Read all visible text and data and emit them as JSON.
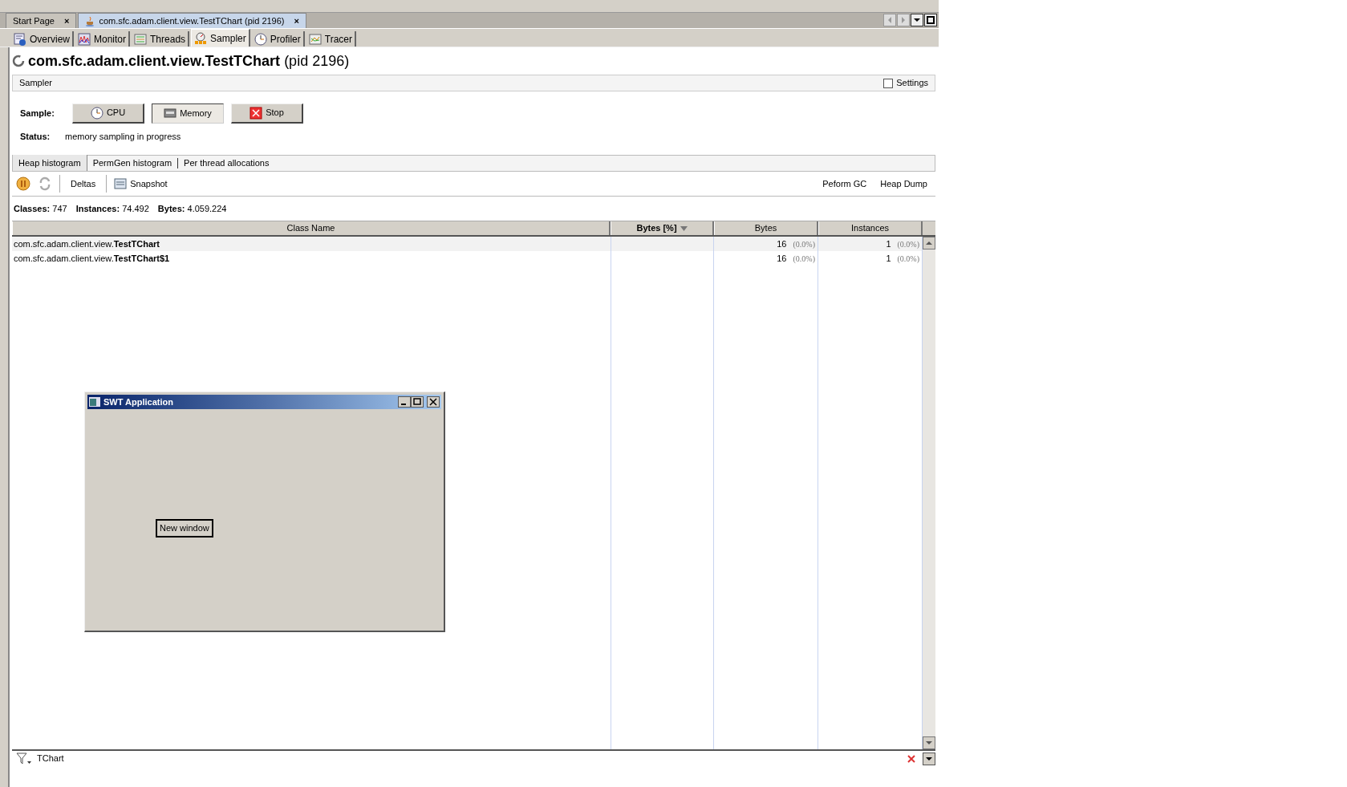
{
  "editor_tabs": [
    {
      "label": "Start Page",
      "close": "×",
      "selected": false
    },
    {
      "label": "com.sfc.adam.client.view.TestTChart (pid 2196)",
      "close": "×",
      "selected": true
    }
  ],
  "view_tabs": [
    {
      "label": "Overview",
      "kind": "overview",
      "selected": false
    },
    {
      "label": "Monitor",
      "kind": "monitor",
      "selected": false
    },
    {
      "label": "Threads",
      "kind": "threads",
      "selected": false
    },
    {
      "label": "Sampler",
      "kind": "sampler",
      "selected": true
    },
    {
      "label": "Profiler",
      "kind": "profiler",
      "selected": false
    },
    {
      "label": "Tracer",
      "kind": "tracer",
      "selected": false
    }
  ],
  "title": {
    "name": "com.sfc.adam.client.view.TestTChart",
    "suffix": "(pid 2196)"
  },
  "sampler": {
    "header": "Sampler",
    "settings": {
      "label": "Settings",
      "checked": false
    },
    "sample_label": "Sample:",
    "buttons": [
      {
        "label": "CPU",
        "kind": "cpu",
        "selected": false
      },
      {
        "label": "Memory",
        "kind": "memory",
        "selected": true
      },
      {
        "label": "Stop",
        "kind": "stop",
        "selected": false
      }
    ],
    "status_label": "Status:",
    "status": "memory sampling in progress"
  },
  "histogram_tabs": [
    {
      "label": "Heap histogram",
      "selected": true
    },
    {
      "label": "PermGen histogram",
      "selected": false
    },
    {
      "label": "Per thread allocations",
      "selected": false
    }
  ],
  "toolbar": {
    "deltas": "Deltas",
    "snapshot": "Snapshot",
    "gc": "Peform GC",
    "dump": "Heap Dump"
  },
  "stats": [
    {
      "label": "Classes:",
      "value": "747"
    },
    {
      "label": "Instances:",
      "value": "74.492"
    },
    {
      "label": "Bytes:",
      "value": "4.059.224"
    }
  ],
  "table": {
    "columns": [
      {
        "label": "Class Name",
        "sorted": false
      },
      {
        "label": "Bytes [%]",
        "sorted": true
      },
      {
        "label": "Bytes",
        "sorted": false
      },
      {
        "label": "Instances",
        "sorted": false
      }
    ],
    "rows": [
      {
        "class_name": "com.sfc.adam.client.view.**TestTChart**",
        "bytes": "16",
        "bytes_pct": "(0.0%)",
        "instances": "1",
        "instances_pct": "(0.0%)"
      },
      {
        "class_name": "com.sfc.adam.client.view.**TestTChart$1**",
        "bytes": "16",
        "bytes_pct": "(0.0%)",
        "instances": "1",
        "instances_pct": "(0.0%)"
      }
    ]
  },
  "filter": {
    "value": "TChart"
  },
  "swt_window": {
    "title": "SWT Application",
    "button": "New window"
  }
}
